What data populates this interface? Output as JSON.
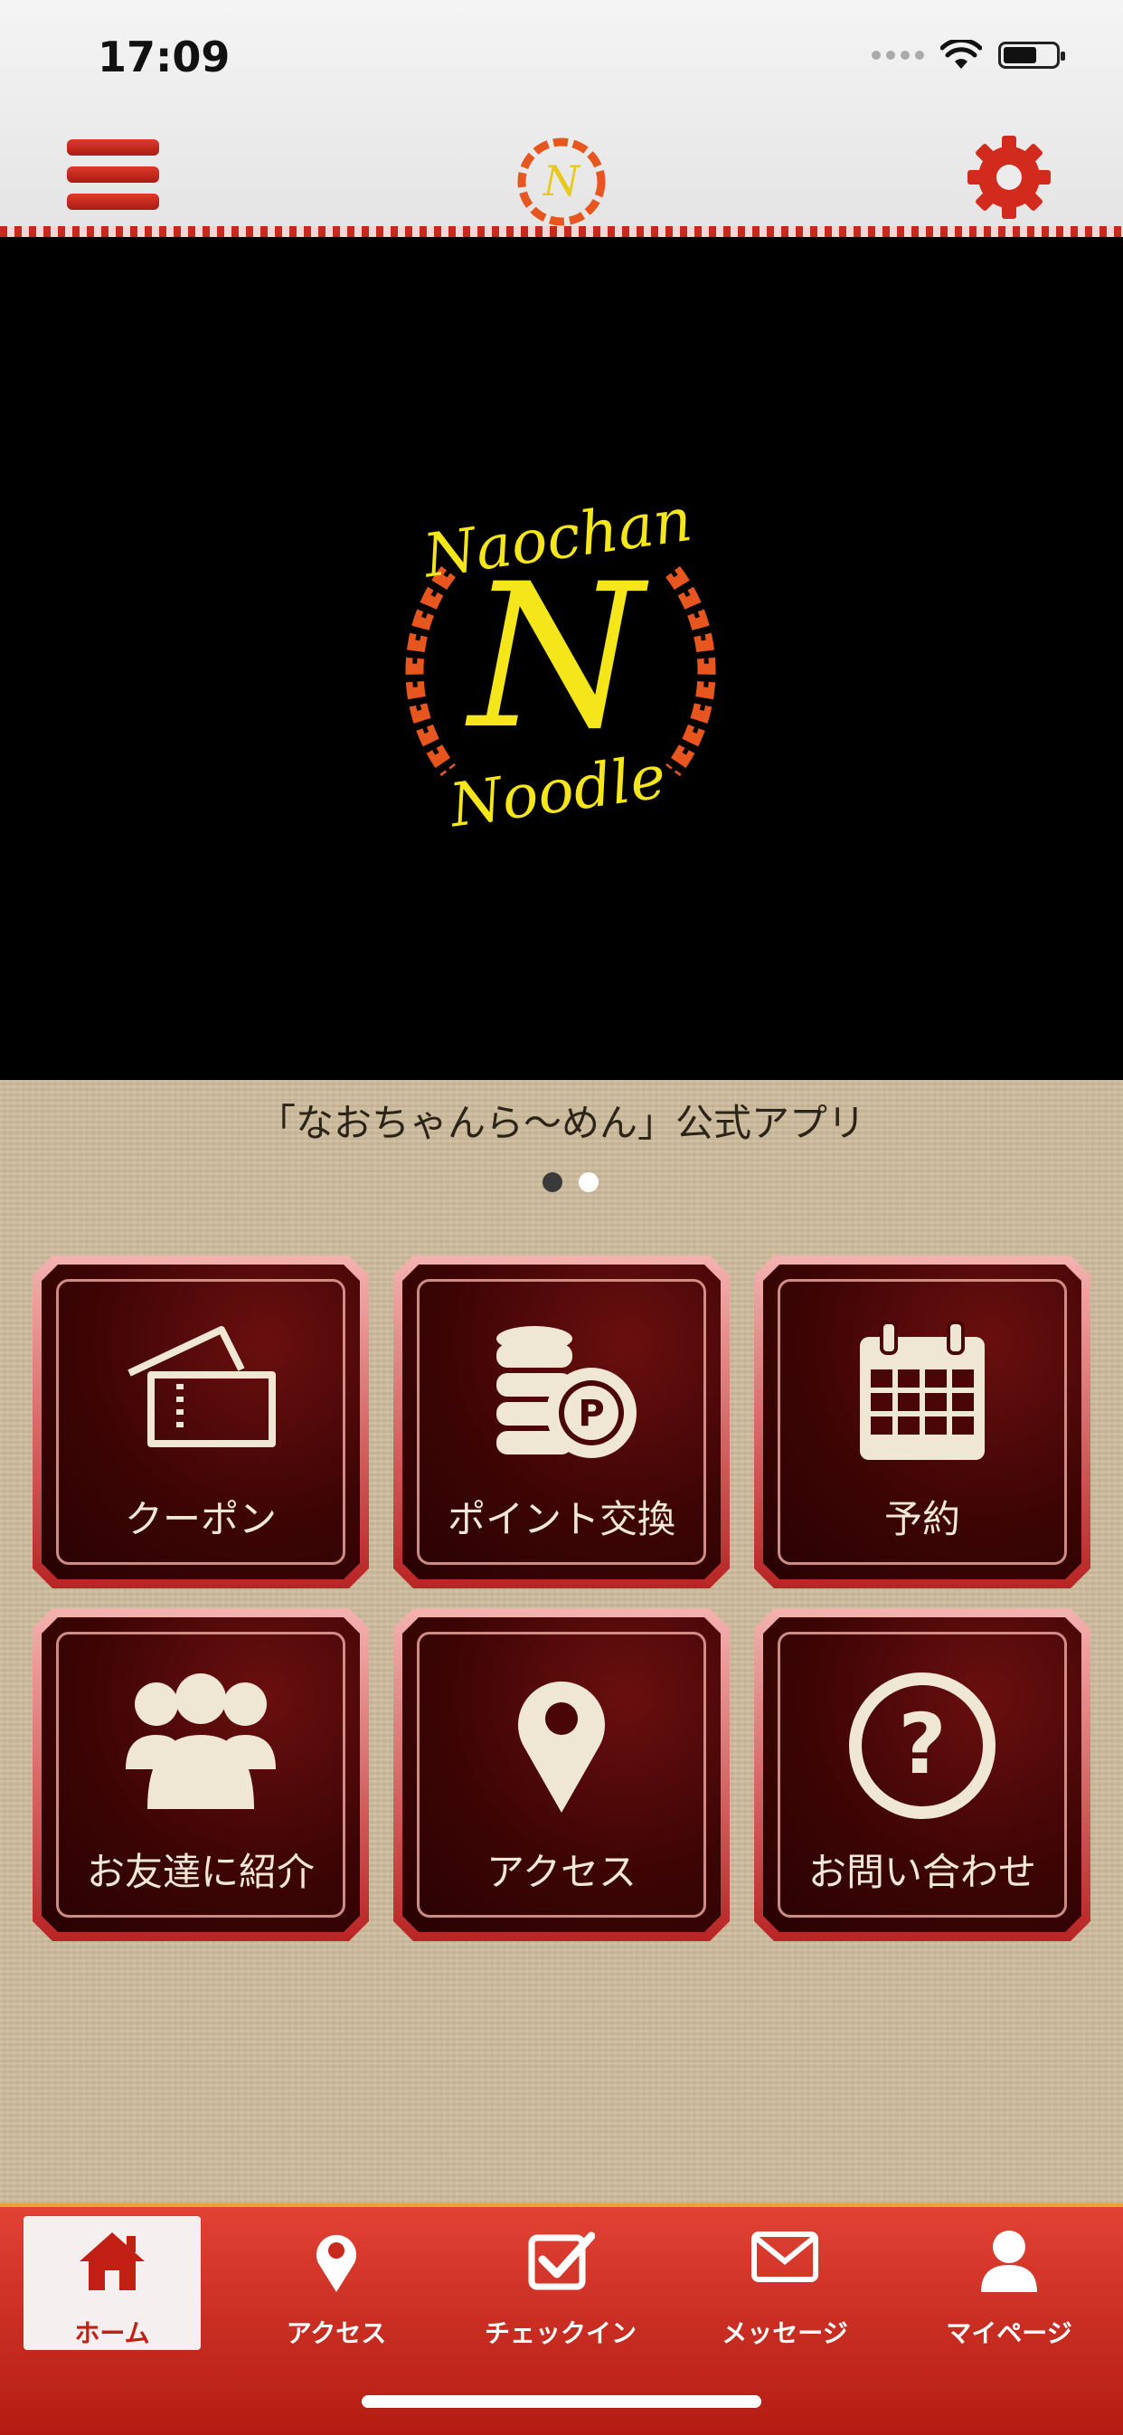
{
  "status_bar": {
    "time": "17:09"
  },
  "header": {
    "menu_icon": "hamburger-menu-icon",
    "logo_icon": "naochan-noodle-logo",
    "settings_icon": "gear-icon"
  },
  "hero": {
    "logo_text_top": "Naochan",
    "logo_letter": "N",
    "logo_text_bottom": "Noodle"
  },
  "subtitle": "「なおちゃんら〜めん」公式アプリ",
  "carousel": {
    "page": 1,
    "total": 2
  },
  "tiles": [
    {
      "label": "クーポン",
      "icon": "ticket-icon"
    },
    {
      "label": "ポイント交換",
      "icon": "coins-point-icon"
    },
    {
      "label": "予約",
      "icon": "calendar-icon"
    },
    {
      "label": "お友達に紹介",
      "icon": "people-icon"
    },
    {
      "label": "アクセス",
      "icon": "map-pin-icon"
    },
    {
      "label": "お問い合わせ",
      "icon": "question-icon"
    }
  ],
  "tabbar": [
    {
      "label": "ホーム",
      "icon": "home-icon",
      "active": true
    },
    {
      "label": "アクセス",
      "icon": "map-pin-icon",
      "active": false
    },
    {
      "label": "チェックイン",
      "icon": "checkin-icon",
      "active": false
    },
    {
      "label": "メッセージ",
      "icon": "mail-icon",
      "active": false
    },
    {
      "label": "マイページ",
      "icon": "user-icon",
      "active": false
    }
  ],
  "colors": {
    "accent_red": "#c8281e",
    "logo_yellow": "#f5e51b",
    "logo_orange": "#e8561f",
    "tile_text": "#f2e8d7"
  }
}
